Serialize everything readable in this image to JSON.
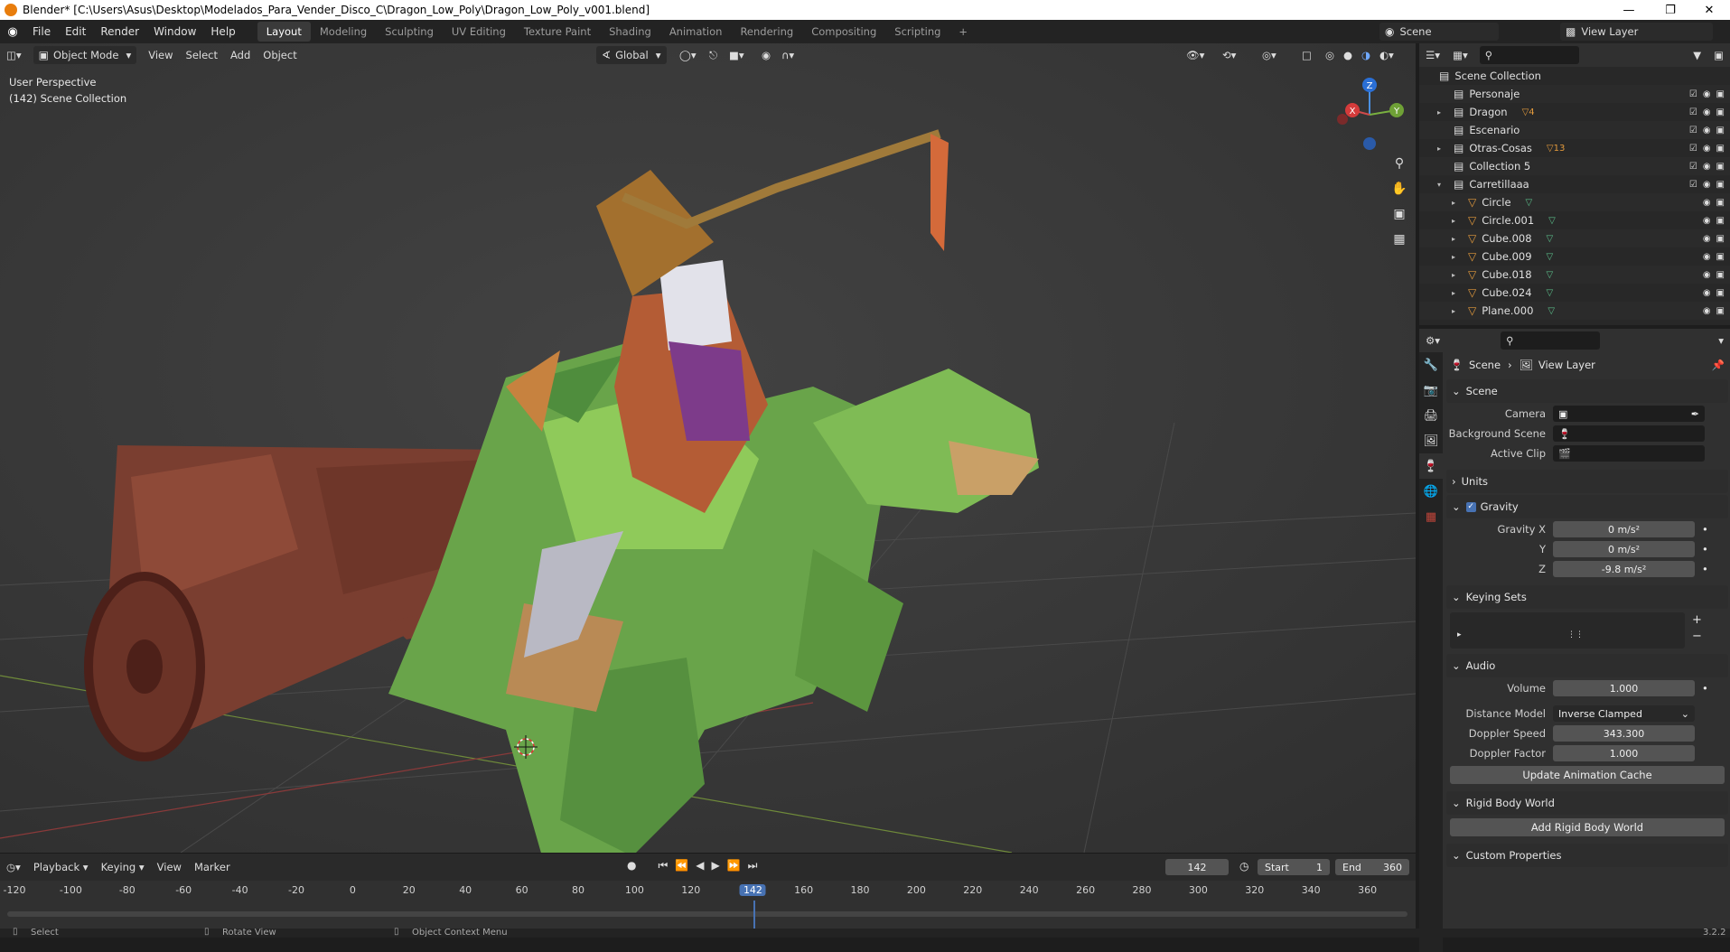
{
  "window": {
    "title": "Blender* [C:\\Users\\Asus\\Desktop\\Modelados_Para_Vender_Disco_C\\Dragon_Low_Poly\\Dragon_Low_Poly_v001.blend]"
  },
  "menu": [
    "File",
    "Edit",
    "Render",
    "Window",
    "Help"
  ],
  "workspaces": [
    "Layout",
    "Modeling",
    "Sculpting",
    "UV Editing",
    "Texture Paint",
    "Shading",
    "Animation",
    "Rendering",
    "Compositing",
    "Scripting"
  ],
  "scene_field": "Scene",
  "viewlayer_field": "View Layer",
  "viewport": {
    "mode": "Object Mode",
    "menus": [
      "View",
      "Select",
      "Add",
      "Object"
    ],
    "orientation": "Global",
    "overlay_line1": "User Perspective",
    "overlay_line2": "(142) Scene Collection",
    "gizmo": {
      "x": "X",
      "y": "Y",
      "z": "Z"
    }
  },
  "outliner": {
    "root": "Scene Collection",
    "rows": [
      {
        "label": "Personaje",
        "badge": ""
      },
      {
        "label": "Dragon",
        "badge": "4"
      },
      {
        "label": "Escenario",
        "badge": ""
      },
      {
        "label": "Otras-Cosas",
        "badge": "13"
      },
      {
        "label": "Collection 5",
        "badge": ""
      },
      {
        "label": "Carretillaaa",
        "badge": ""
      },
      {
        "label": "Circle",
        "badge": ""
      },
      {
        "label": "Circle.001",
        "badge": ""
      },
      {
        "label": "Cube.008",
        "badge": ""
      },
      {
        "label": "Cube.009",
        "badge": ""
      },
      {
        "label": "Cube.018",
        "badge": ""
      },
      {
        "label": "Cube.024",
        "badge": ""
      },
      {
        "label": "Plane.000",
        "badge": ""
      }
    ]
  },
  "properties": {
    "breadcrumb": {
      "scene": "Scene",
      "layer": "View Layer"
    },
    "scene_section": "Scene",
    "camera_label": "Camera",
    "bg_scene_label": "Background Scene",
    "active_clip_label": "Active Clip",
    "units_section": "Units",
    "gravity_section": "Gravity",
    "gravity_x_label": "Gravity X",
    "gravity_x": "0 m/s²",
    "gravity_y_label": "Y",
    "gravity_y": "0 m/s²",
    "gravity_z_label": "Z",
    "gravity_z": "-9.8 m/s²",
    "keying_sets_section": "Keying Sets",
    "audio_section": "Audio",
    "volume_label": "Volume",
    "volume": "1.000",
    "distance_model_label": "Distance Model",
    "distance_model": "Inverse Clamped",
    "doppler_speed_label": "Doppler Speed",
    "doppler_speed": "343.300",
    "doppler_factor_label": "Doppler Factor",
    "doppler_factor": "1.000",
    "update_anim_cache": "Update Animation Cache",
    "rigid_body_section": "Rigid Body World",
    "add_rigid_body": "Add Rigid Body World",
    "custom_props_section": "Custom Properties",
    "version": "3.2.2"
  },
  "timeline": {
    "menus": [
      "Playback",
      "Keying",
      "View",
      "Marker"
    ],
    "current_frame": "142",
    "start_label": "Start",
    "start": "1",
    "end_label": "End",
    "end": "360",
    "ruler": [
      "-120",
      "-100",
      "-80",
      "-60",
      "-40",
      "-20",
      "0",
      "20",
      "40",
      "60",
      "80",
      "100",
      "120",
      "142",
      "160",
      "180",
      "200",
      "220",
      "240",
      "260",
      "280",
      "300",
      "320",
      "340",
      "360"
    ]
  },
  "statusbar": {
    "select": "Select",
    "rotate": "Rotate View",
    "context": "Object Context Menu"
  }
}
